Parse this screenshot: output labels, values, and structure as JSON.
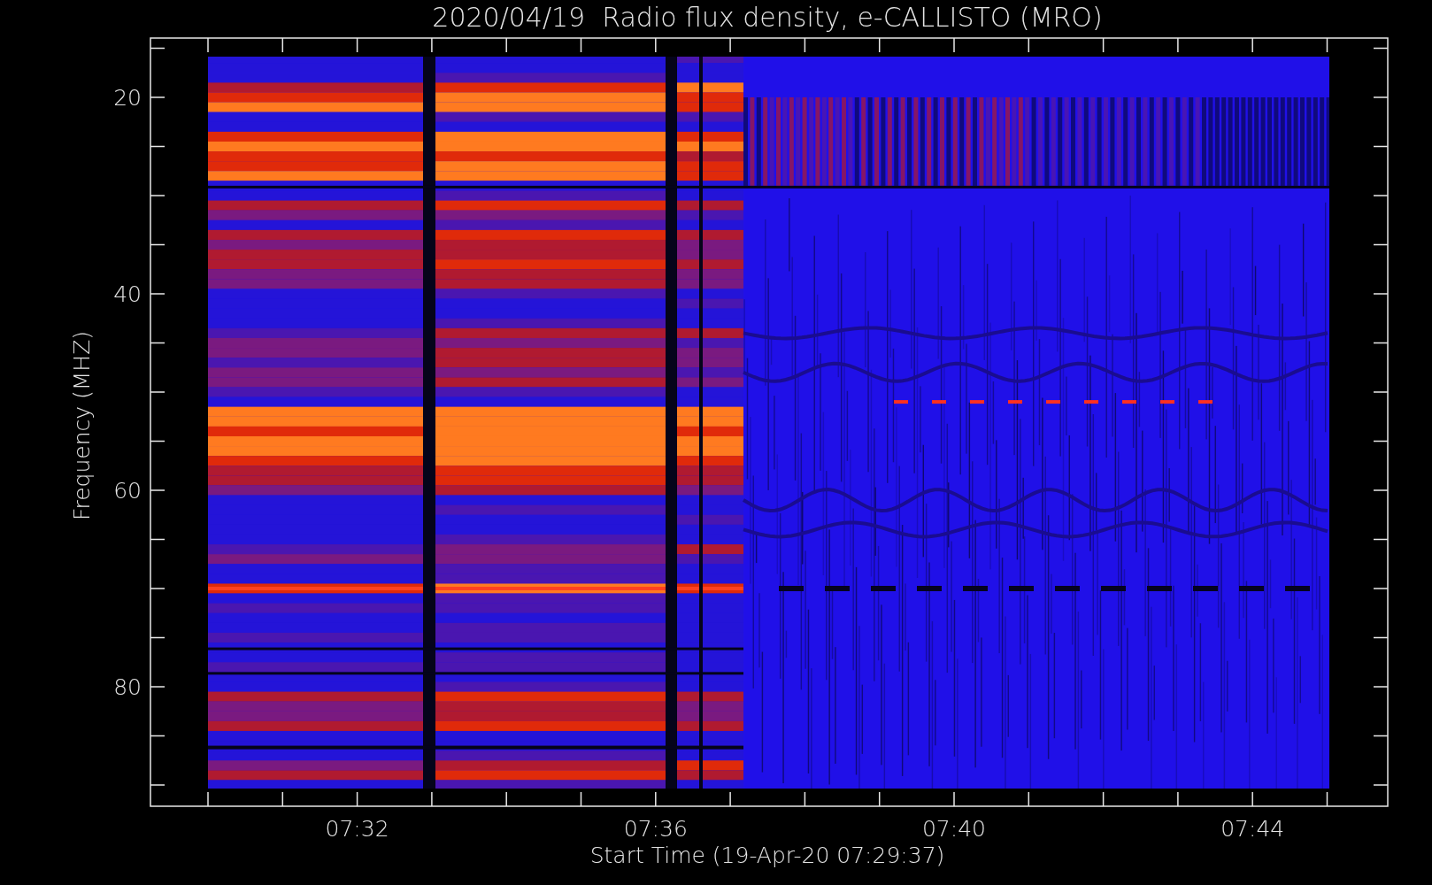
{
  "plot": {
    "title": "2020/04/19  Radio flux density, e-CALLISTO (MRO)",
    "ylabel": "Frequency (MHZ)",
    "xlabel": "Start Time (19-Apr-20 07:29:37)",
    "yticks": [
      "20",
      "40",
      "60",
      "80"
    ],
    "xticks": [
      "07:32",
      "07:36",
      "07:40",
      "07:44"
    ]
  }
}
